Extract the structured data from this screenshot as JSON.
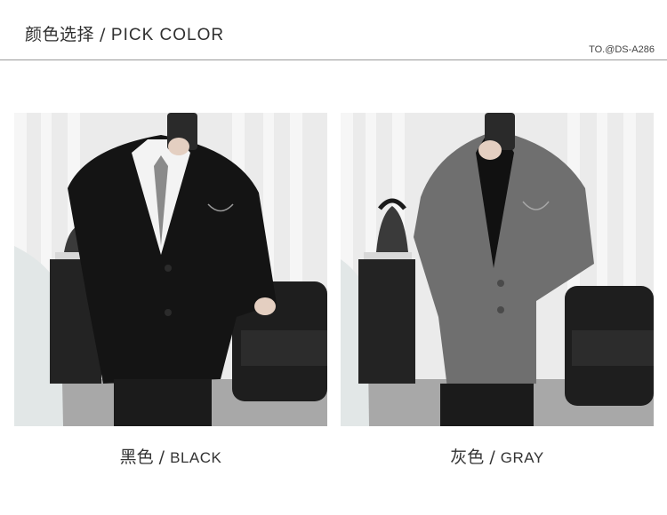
{
  "header": {
    "title_cn": "颜色选择",
    "title_sep": "/",
    "title_en": "PICK COLOR",
    "product_code": "TO.@DS-A286"
  },
  "options": [
    {
      "name_cn": "黑色",
      "sep": "/",
      "name_en": "BLACK",
      "color": "#151515"
    },
    {
      "name_cn": "灰色",
      "sep": "/",
      "name_en": "GRAY",
      "color": "#6e6e6e"
    }
  ]
}
